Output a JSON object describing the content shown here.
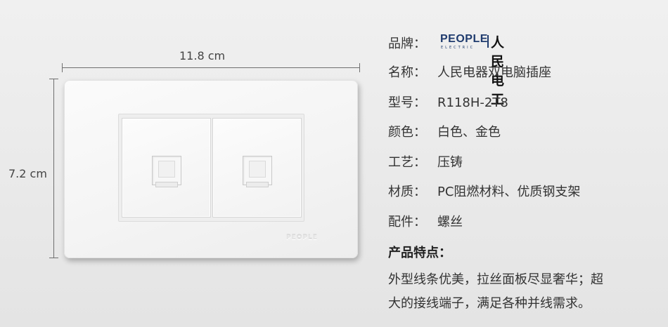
{
  "dimensions": {
    "width_label": "11.8 cm",
    "height_label": "7.2 cm"
  },
  "plate": {
    "mark_text": "PEOPLE"
  },
  "brand": {
    "key": "品牌：",
    "logo_en": "PEOPLE",
    "logo_sub": "ELECTRIC",
    "logo_cn": "人民电工",
    "logo_color": "#1f3b6e"
  },
  "specs": [
    {
      "key": "名称：",
      "value": "人民电器双电脑插座"
    },
    {
      "key": "型号：",
      "value": "R118H-2T8"
    },
    {
      "key": "颜色：",
      "value": "白色、金色"
    },
    {
      "key": "工艺：",
      "value": "压铸"
    },
    {
      "key": "材质：",
      "value": "PC阻燃材料、优质钢支架"
    },
    {
      "key": "配件：",
      "value": "螺丝"
    }
  ],
  "features": {
    "title": "产品特点：",
    "line1": "外型线条优美，拉丝面板尽显奢华；超",
    "line2": "大的接线端子，满足各种并线需求。"
  }
}
